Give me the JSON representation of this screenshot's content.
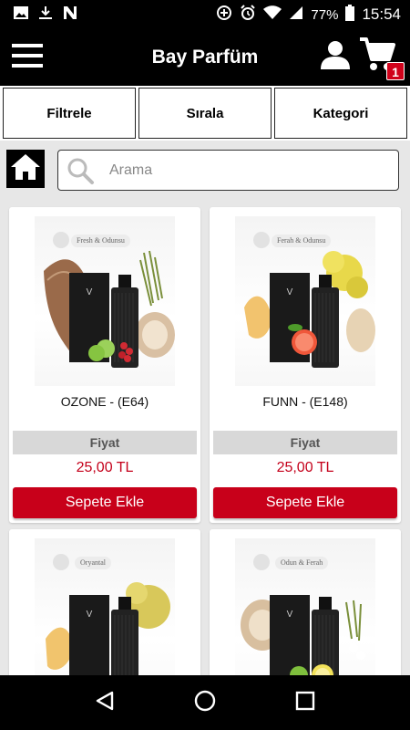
{
  "status_bar": {
    "battery": "77%",
    "time": "15:54"
  },
  "app_bar": {
    "title": "Bay Parfüm",
    "cart_count": "1"
  },
  "toolbar": {
    "filter_label": "Filtrele",
    "sort_label": "Sırala",
    "category_label": "Kategori"
  },
  "search": {
    "placeholder": "Arama",
    "value": ""
  },
  "products": [
    {
      "name": "OZONE - (E64)",
      "tag": "Fresh & Odunsu",
      "price_label": "Fiyat",
      "price": "25,00 TL",
      "button": "Sepete Ekle"
    },
    {
      "name": "FUNN - (E148)",
      "tag": "Ferah & Odunsu",
      "price_label": "Fiyat",
      "price": "25,00 TL",
      "button": "Sepete Ekle"
    },
    {
      "name": "",
      "tag": "Oryantal",
      "price_label": "",
      "price": "",
      "button": ""
    },
    {
      "name": "",
      "tag": "Odun & Ferah",
      "price_label": "",
      "price": "",
      "button": ""
    }
  ],
  "colors": {
    "accent_red": "#c8001a",
    "bar_black": "#000000",
    "background": "#e7e7e7"
  },
  "icons": [
    "image-icon",
    "download-icon",
    "n-icon",
    "data-saver-icon",
    "alarm-icon",
    "wifi-icon",
    "signal-icon",
    "battery-icon",
    "menu-icon",
    "user-icon",
    "cart-icon",
    "home-icon",
    "search-icon",
    "back-icon",
    "home-nav-icon",
    "recents-icon"
  ]
}
